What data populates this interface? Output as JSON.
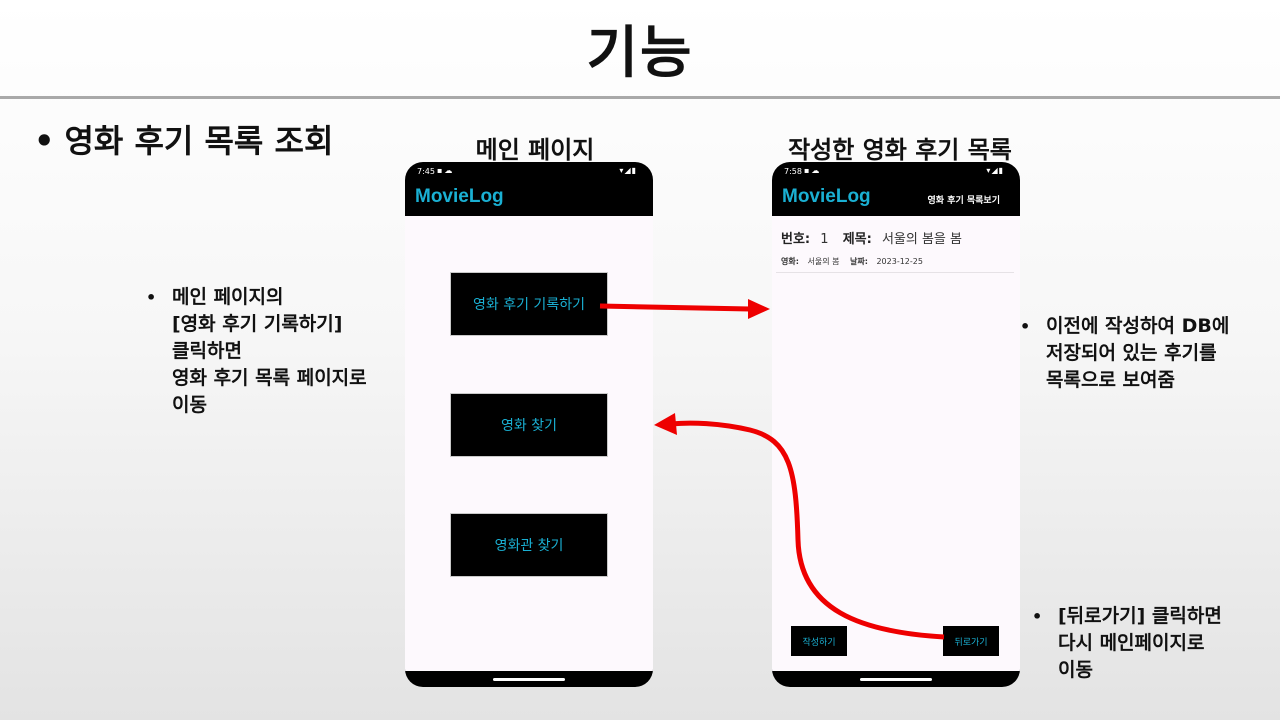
{
  "slide": {
    "title": "기능",
    "heading_bullet": "•",
    "heading": "영화 후기 목록 조회"
  },
  "captions": {
    "main_page": "메인 페이지",
    "review_list": "작성한 영화 후기 목록"
  },
  "notes": {
    "left": [
      "메인 페이지의",
      "[영화 후기 기록하기]",
      "클릭하면",
      "영화 후기 목록 페이지로",
      "이동"
    ],
    "right_top": [
      "이전에 작성하여 DB에",
      "저장되어 있는 후기를",
      "목록으로 보여줌"
    ],
    "right_bottom": [
      "[뒤로가기] 클릭하면",
      "다시 메인페이지로",
      "이동"
    ]
  },
  "phone_main": {
    "status_time": "7:45",
    "app_title": "MovieLog",
    "buttons": [
      "영화 후기 기록하기",
      "영화 찾기",
      "영화관 찾기"
    ]
  },
  "phone_list": {
    "status_time": "7:58",
    "app_title": "MovieLog",
    "app_action": "영화 후기 목록보기",
    "review": {
      "number_label": "번호:",
      "number": "1",
      "title_label": "제목:",
      "title": "서울의 봄을 봄",
      "movie_label": "영화:",
      "movie": "서울의 봄",
      "date_label": "날짜:",
      "date": "2023-12-25"
    },
    "write_button": "작성하기",
    "back_button": "뒤로가기"
  },
  "colors": {
    "accent": "#1ab0d3",
    "arrow": "#ee0000"
  },
  "icons": {
    "status_left": "sim-cloud-icons",
    "status_right": "wifi-signal-battery-icons"
  }
}
